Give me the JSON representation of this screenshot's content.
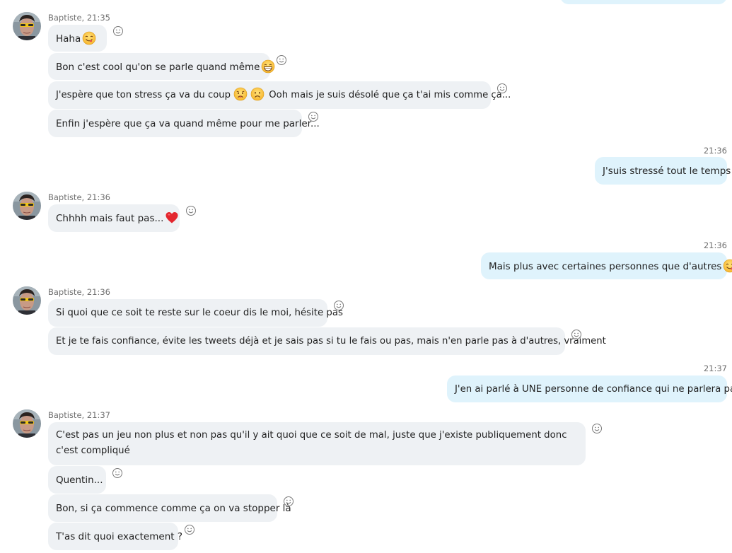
{
  "conversation": {
    "group1": {
      "sender": "Baptiste, 21:35",
      "m1": "Haha",
      "m2": "Bon c'est cool qu'on se parle quand même",
      "m3a": "J'espère que ton stress ça va du coup",
      "m3b": "Ooh mais je suis désolé que ça t'ai mis comme ça...",
      "m4": "Enfin j'espère que ça va quand même pour me parler..."
    },
    "out1": {
      "time": "21:36",
      "text": "J'suis stressé tout le temps"
    },
    "group2": {
      "sender": "Baptiste, 21:36",
      "m1": "Chhhh mais faut pas..."
    },
    "out2": {
      "time": "21:36",
      "text": "Mais plus avec certaines personnes que d'autres"
    },
    "group3": {
      "sender": "Baptiste, 21:36",
      "m1": "Si quoi que ce soit te reste sur le coeur dis le moi, hésite pas",
      "m2": "Et je te fais confiance, évite les tweets déjà et je sais pas si tu le fais ou pas, mais n'en parle pas à d'autres, vraiment"
    },
    "out3": {
      "time": "21:37",
      "text": "J'en ai parlé à UNE personne de confiance qui ne parlera pas"
    },
    "group4": {
      "sender": "Baptiste, 21:37",
      "m1": "C'est pas un jeu non plus et non pas qu'il y ait quoi que ce soit de mal, juste que j'existe publiquement donc c'est compliqué",
      "m2": "Quentin...",
      "m3": "Bon, si ça commence comme ça on va stopper là",
      "m4": "T'as dit quoi exactement ?"
    }
  },
  "icons": {
    "reaction": "smiley-outline-icon",
    "emojis": [
      "yum-emoji-icon",
      "grin-emoji-icon",
      "frown-emoji-icon",
      "sad-emoji-icon",
      "heart-emoji-icon"
    ]
  },
  "colors": {
    "incoming_bubble": "#eef1f4",
    "outgoing_bubble": "#dff3fc",
    "meta_text": "#6f6f6f"
  }
}
